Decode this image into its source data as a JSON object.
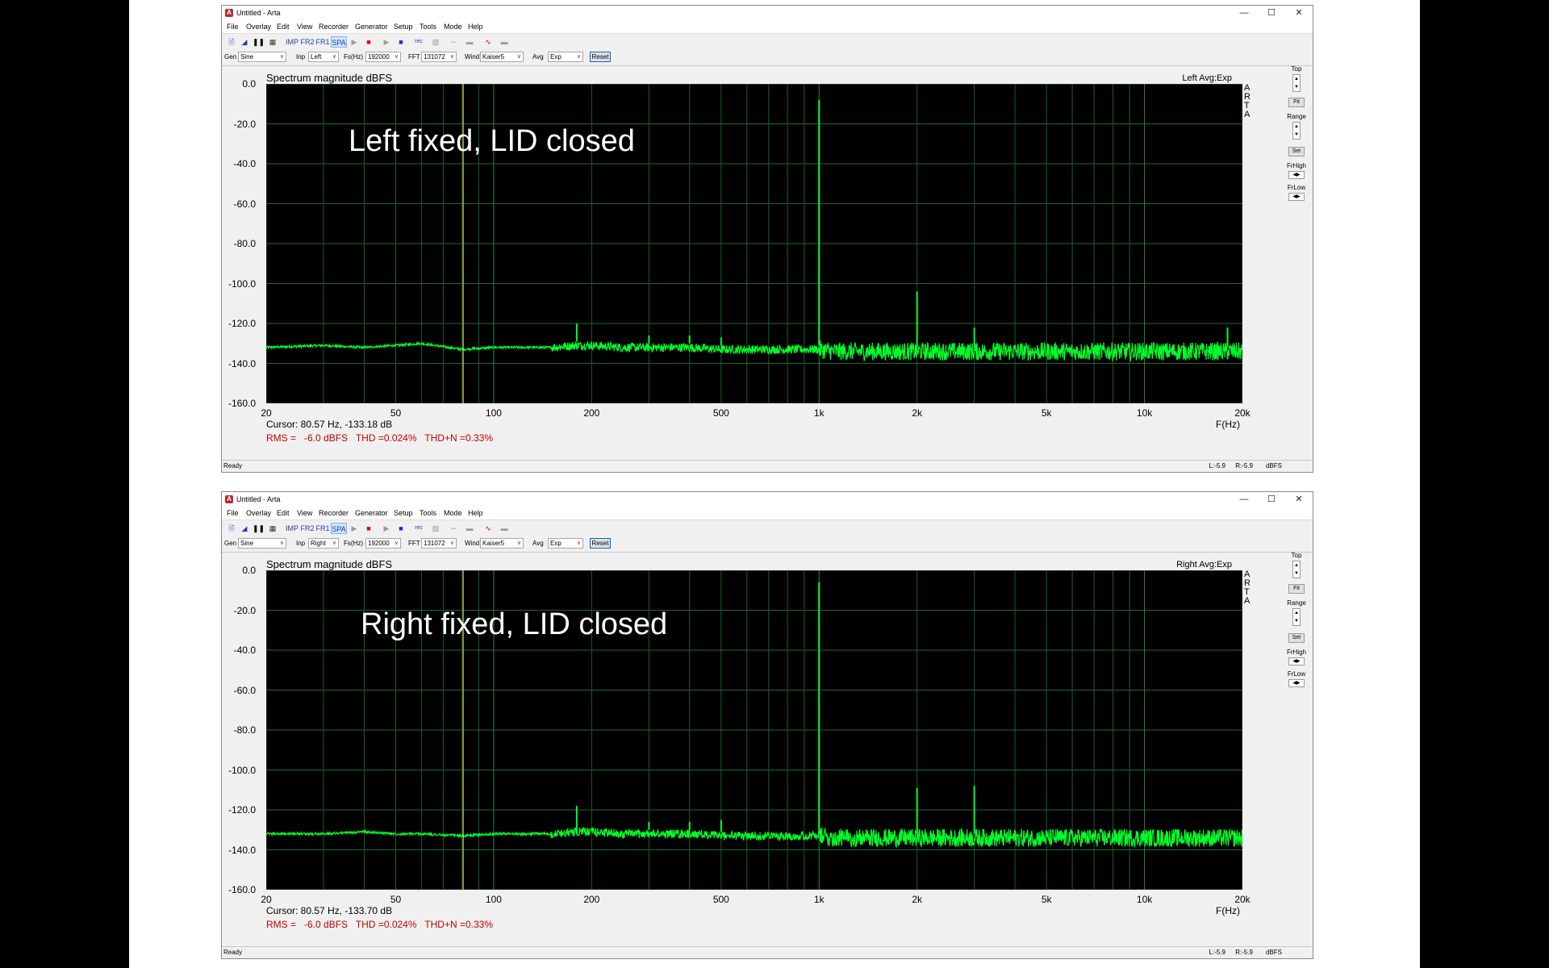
{
  "windows": [
    {
      "title": "Untitled - Arta",
      "menu": [
        "File",
        "Overlay",
        "Edit",
        "View",
        "Recorder",
        "Generator",
        "Setup",
        "Tools",
        "Mode",
        "Help"
      ],
      "modes": {
        "imp": "IMP",
        "fr2": "FR2",
        "fr1": "FR1",
        "spa": "SPA"
      },
      "controls": {
        "gen_label": "Gen",
        "gen_value": "Sine",
        "inp_label": "Inp",
        "inp_value": "Left",
        "fs_label": "Fs(Hz)",
        "fs_value": "192000",
        "fft_label": "FFT",
        "fft_value": "131072",
        "wind_label": "Wind",
        "wind_value": "Kaiser5",
        "avg_label": "Avg",
        "avg_value": "Exp",
        "reset_label": "Reset"
      },
      "plot_title": "Spectrum magnitude dBFS",
      "channel_info": "Left  Avg:Exp",
      "arta_mark": [
        "A",
        "R",
        "T",
        "A"
      ],
      "overlay_text": "Left fixed, LID closed",
      "y_ticks": [
        "0.0",
        "-20.0",
        "-40.0",
        "-60.0",
        "-80.0",
        "-100.0",
        "-120.0",
        "-140.0",
        "-160.0"
      ],
      "x_ticks": [
        "20",
        "50",
        "100",
        "200",
        "500",
        "1k",
        "2k",
        "5k",
        "10k",
        "20k"
      ],
      "x_unit": "F(Hz)",
      "cursor_text": "Cursor: 80.57 Hz, -133.18 dB",
      "measurements": "RMS =   -6.0 dBFS   THD =0.024%   THD+N =0.33%",
      "right_panel": {
        "top": "Top",
        "fit": "Fit",
        "range": "Range",
        "set": "Set",
        "frhigh": "FrHigh",
        "frlow": "FrLow"
      },
      "status": {
        "ready": "Ready",
        "l": "L:-5.9",
        "r": "R:-5.9",
        "unit": "dBFS"
      },
      "chart_data": {
        "type": "line",
        "title": "Spectrum magnitude dBFS",
        "xlabel": "F(Hz)",
        "x_scale": "log",
        "xlim": [
          20,
          20000
        ],
        "ylim": [
          -160,
          0
        ],
        "grid": true,
        "series": [
          {
            "name": "Left",
            "color": "#00ff2a",
            "x": [
              20,
              30,
              40,
              50,
              60,
              80,
              100,
              150,
              180,
              200,
              250,
              300,
              400,
              500,
              700,
              900,
              1000,
              1100,
              1500,
              2000,
              2500,
              3000,
              4000,
              5000,
              7000,
              10000,
              15000,
              20000
            ],
            "y": [
              -132,
              -131,
              -132,
              -131,
              -130,
              -133,
              -132,
              -132,
              -131,
              -131,
              -132,
              -132,
              -132,
              -133,
              -133,
              -133,
              -133,
              -134,
              -134,
              -134,
              -134,
              -134,
              -134,
              -134,
              -134,
              -134,
              -134,
              -134
            ]
          }
        ],
        "peaks": [
          {
            "x": 60,
            "y": -128
          },
          {
            "x": 180,
            "y": -120
          },
          {
            "x": 300,
            "y": -126
          },
          {
            "x": 400,
            "y": -126
          },
          {
            "x": 500,
            "y": -127
          },
          {
            "x": 1000,
            "y": -8
          },
          {
            "x": 2000,
            "y": -104
          },
          {
            "x": 3000,
            "y": -122
          },
          {
            "x": 18000,
            "y": -122
          }
        ],
        "cursor_x": 80.57
      }
    },
    {
      "title": "Untitled - Arta",
      "menu": [
        "File",
        "Overlay",
        "Edit",
        "View",
        "Recorder",
        "Generator",
        "Setup",
        "Tools",
        "Mode",
        "Help"
      ],
      "modes": {
        "imp": "IMP",
        "fr2": "FR2",
        "fr1": "FR1",
        "spa": "SPA"
      },
      "controls": {
        "gen_label": "Gen",
        "gen_value": "Sine",
        "inp_label": "Inp",
        "inp_value": "Right",
        "fs_label": "Fs(Hz)",
        "fs_value": "192000",
        "fft_label": "FFT",
        "fft_value": "131072",
        "wind_label": "Wind",
        "wind_value": "Kaiser5",
        "avg_label": "Avg",
        "avg_value": "Exp",
        "reset_label": "Reset"
      },
      "plot_title": "Spectrum magnitude dBFS",
      "channel_info": "Right Avg:Exp",
      "arta_mark": [
        "A",
        "R",
        "T",
        "A"
      ],
      "overlay_text": "Right fixed, LID closed",
      "y_ticks": [
        "0.0",
        "-20.0",
        "-40.0",
        "-60.0",
        "-80.0",
        "-100.0",
        "-120.0",
        "-140.0",
        "-160.0"
      ],
      "x_ticks": [
        "20",
        "50",
        "100",
        "200",
        "500",
        "1k",
        "2k",
        "5k",
        "10k",
        "20k"
      ],
      "x_unit": "F(Hz)",
      "cursor_text": "Cursor: 80.57 Hz, -133.70 dB",
      "measurements": "RMS =   -6.0 dBFS   THD =0.024%   THD+N =0.33%",
      "right_panel": {
        "top": "Top",
        "fit": "Fit",
        "range": "Range",
        "set": "Set",
        "frhigh": "FrHigh",
        "frlow": "FrLow"
      },
      "status": {
        "ready": "Ready",
        "l": "L:-5.9",
        "r": "R:-5.9",
        "unit": "dBFS"
      },
      "chart_data": {
        "type": "line",
        "title": "Spectrum magnitude dBFS",
        "xlabel": "F(Hz)",
        "x_scale": "log",
        "xlim": [
          20,
          20000
        ],
        "ylim": [
          -160,
          0
        ],
        "grid": true,
        "series": [
          {
            "name": "Right",
            "color": "#00ff2a",
            "x": [
              20,
              30,
              40,
              50,
              60,
              80,
              100,
              150,
              180,
              200,
              250,
              300,
              400,
              500,
              700,
              900,
              1000,
              1100,
              1500,
              2000,
              2500,
              3000,
              4000,
              5000,
              7000,
              10000,
              15000,
              20000
            ],
            "y": [
              -132,
              -132,
              -131,
              -132,
              -132,
              -133,
              -132,
              -132,
              -131,
              -131,
              -132,
              -132,
              -132,
              -133,
              -133,
              -133,
              -133,
              -134,
              -134,
              -134,
              -134,
              -134,
              -134,
              -134,
              -134,
              -134,
              -134,
              -134
            ]
          }
        ],
        "peaks": [
          {
            "x": 180,
            "y": -118
          },
          {
            "x": 300,
            "y": -126
          },
          {
            "x": 400,
            "y": -126
          },
          {
            "x": 500,
            "y": -125
          },
          {
            "x": 1000,
            "y": -6
          },
          {
            "x": 2000,
            "y": -109
          },
          {
            "x": 3000,
            "y": -108
          }
        ],
        "cursor_x": 80.57
      }
    }
  ]
}
